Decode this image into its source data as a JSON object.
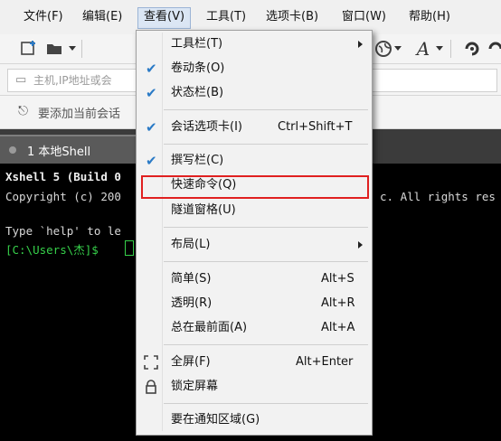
{
  "menubar": {
    "items": [
      "文件(F)",
      "编辑(E)",
      "查看(V)",
      "工具(T)",
      "选项卡(B)",
      "窗口(W)",
      "帮助(H)"
    ],
    "active": "查看(V)"
  },
  "toolbar": {
    "icons": [
      "new-session-icon",
      "open-folder-icon",
      "globe-icon",
      "font-icon",
      "xshell-icon"
    ]
  },
  "address_bar": {
    "placeholder": "主机,IP地址或会"
  },
  "hint_bar": {
    "text": "要添加当前会话"
  },
  "tabs": [
    {
      "label": "1 本地Shell"
    }
  ],
  "terminal": {
    "lines": [
      "Xshell 5 (Build 0",
      "Copyright (c) 200",
      "",
      "Type `help' to le",
      "[C:\\Users\\杰]$ "
    ],
    "right_fragment": "c. All rights res"
  },
  "view_menu": {
    "items": [
      {
        "label": "工具栏(T)",
        "shortcut": "",
        "checked": false,
        "submenu": true
      },
      {
        "label": "卷动条(O)",
        "shortcut": "",
        "checked": true,
        "submenu": false
      },
      {
        "label": "状态栏(B)",
        "shortcut": "",
        "checked": true,
        "submenu": false
      },
      {
        "label": "会话选项卡(I)",
        "shortcut": "Ctrl+Shift+T",
        "checked": true,
        "submenu": false
      },
      {
        "label": "撰写栏(C)",
        "shortcut": "",
        "checked": true,
        "submenu": false
      },
      {
        "label": "快速命令(Q)",
        "shortcut": "",
        "checked": false,
        "submenu": false,
        "highlighted": true
      },
      {
        "label": "隧道窗格(U)",
        "shortcut": "",
        "checked": false,
        "submenu": false
      },
      {
        "label": "布局(L)",
        "shortcut": "",
        "checked": false,
        "submenu": true
      },
      {
        "label": "简单(S)",
        "shortcut": "Alt+S",
        "checked": false,
        "submenu": false
      },
      {
        "label": "透明(R)",
        "shortcut": "Alt+R",
        "checked": false,
        "submenu": false
      },
      {
        "label": "总在最前面(A)",
        "shortcut": "Alt+A",
        "checked": false,
        "submenu": false
      },
      {
        "label": "全屏(F)",
        "shortcut": "Alt+Enter",
        "checked": false,
        "submenu": false,
        "icon": "fullscreen-icon"
      },
      {
        "label": "锁定屏幕",
        "shortcut": "",
        "checked": false,
        "submenu": false,
        "icon": "lock-icon"
      },
      {
        "label": "要在通知区域(G)",
        "shortcut": "",
        "checked": false,
        "submenu": false
      }
    ]
  },
  "colors": {
    "check": "#2a7ac6",
    "highlight_box": "#e02020",
    "terminal_prompt": "#36d04a"
  }
}
